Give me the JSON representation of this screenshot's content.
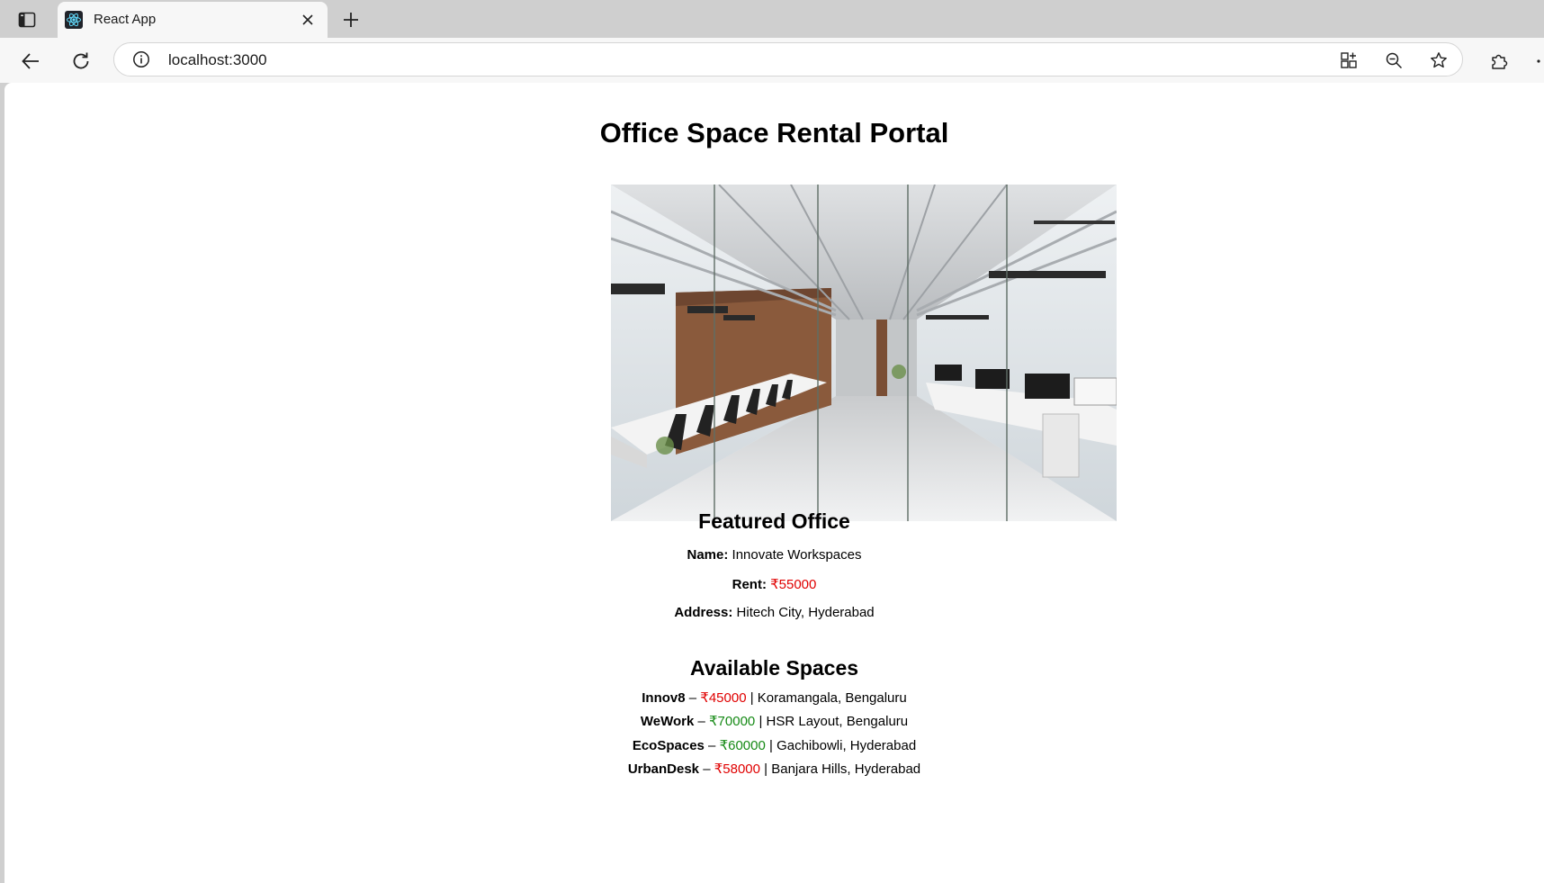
{
  "browser": {
    "tab_title": "React App",
    "url": "localhost:3000",
    "icons": [
      "sidebar-toggle-icon",
      "react-logo-icon",
      "close-icon",
      "plus-icon",
      "back-arrow-icon",
      "reload-icon",
      "info-icon",
      "app-install-icon",
      "zoom-out-icon",
      "favorite-star-icon",
      "extensions-icon"
    ]
  },
  "page": {
    "title": "Office Space Rental Portal",
    "hero_image_alt": "Office interior",
    "featured": {
      "heading": "Featured Office",
      "name_label": "Name:",
      "name_value": "Innovate Workspaces",
      "rent_label": "Rent:",
      "rent_value": "₹55000",
      "rent_color": "#e00000",
      "address_label": "Address:",
      "address_value": "Hitech City, Hyderabad"
    },
    "available": {
      "heading": "Available Spaces",
      "dash": "–",
      "separator": "|",
      "items": [
        {
          "name": "Innov8",
          "rent": "₹45000",
          "rent_color": "#e00000",
          "location": "Koramangala, Bengaluru"
        },
        {
          "name": "WeWork",
          "rent": "₹70000",
          "rent_color": "#168a16",
          "location": "HSR Layout, Bengaluru"
        },
        {
          "name": "EcoSpaces",
          "rent": "₹60000",
          "rent_color": "#168a16",
          "location": "Gachibowli, Hyderabad"
        },
        {
          "name": "UrbanDesk",
          "rent": "₹58000",
          "rent_color": "#e00000",
          "location": "Banjara Hills, Hyderabad"
        }
      ]
    }
  }
}
